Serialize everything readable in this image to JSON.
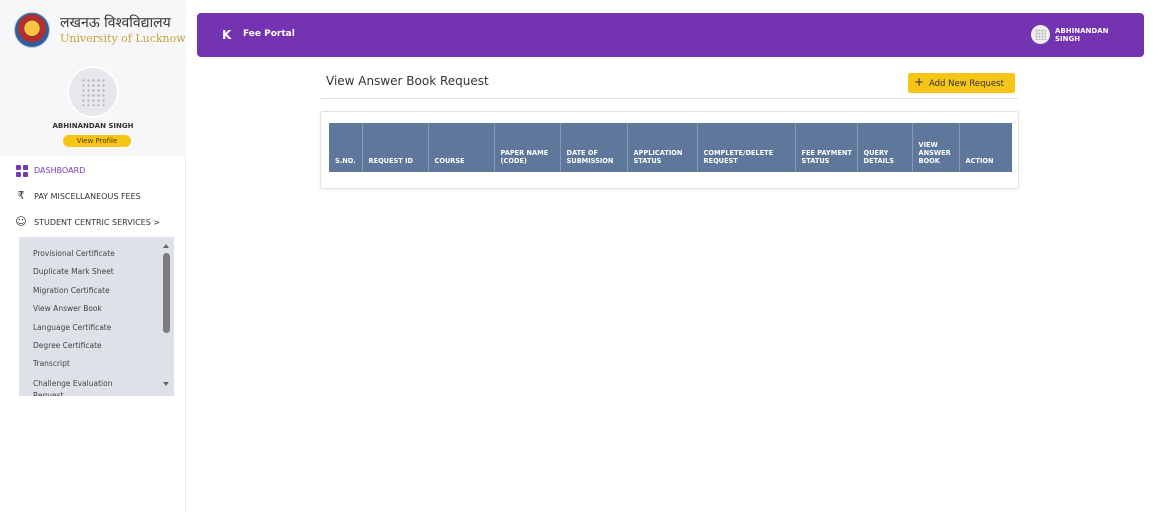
{
  "brand": {
    "hindi": "लखनऊ विश्वविद्यालय",
    "english": "University of Lucknow"
  },
  "profile": {
    "name": "ABHINANDAN SINGH",
    "view_profile": "View Profile"
  },
  "nav": {
    "dashboard": "DASHBOARD",
    "pay_fees": "PAY MISCELLANEOUS FEES",
    "student_services": "STUDENT CENTRIC SERVICES",
    "student_services_chevron": ">"
  },
  "submenu": {
    "items": [
      "Provisional Certificate",
      "Duplicate Mark Sheet",
      "Migration Certificate",
      "View Answer Book",
      "Language Certificate",
      "Degree Certificate",
      "Transcript",
      "Challenge Evaluation Request"
    ]
  },
  "header": {
    "collapse_icon": "K",
    "portal_title": "Fee Portal",
    "user_name": "ABHINANDAN SINGH"
  },
  "main": {
    "title": "View Answer Book Request",
    "add_button": "Add New Request",
    "add_icon": "+"
  },
  "table": {
    "columns": [
      "S.NO.",
      "REQUEST ID",
      "COURSE",
      "PAPER NAME (CODE)",
      "DATE OF SUBMISSION",
      "APPLICATION STATUS",
      "COMPLETE/DELETE REQUEST",
      "FEE PAYMENT STATUS",
      "QUERY DETAILS",
      "VIEW ANSWER BOOK",
      "ACTION"
    ],
    "header_color": "#5e779b"
  },
  "colors": {
    "accent": "#7433b0",
    "button_yellow": "#f5c518"
  }
}
